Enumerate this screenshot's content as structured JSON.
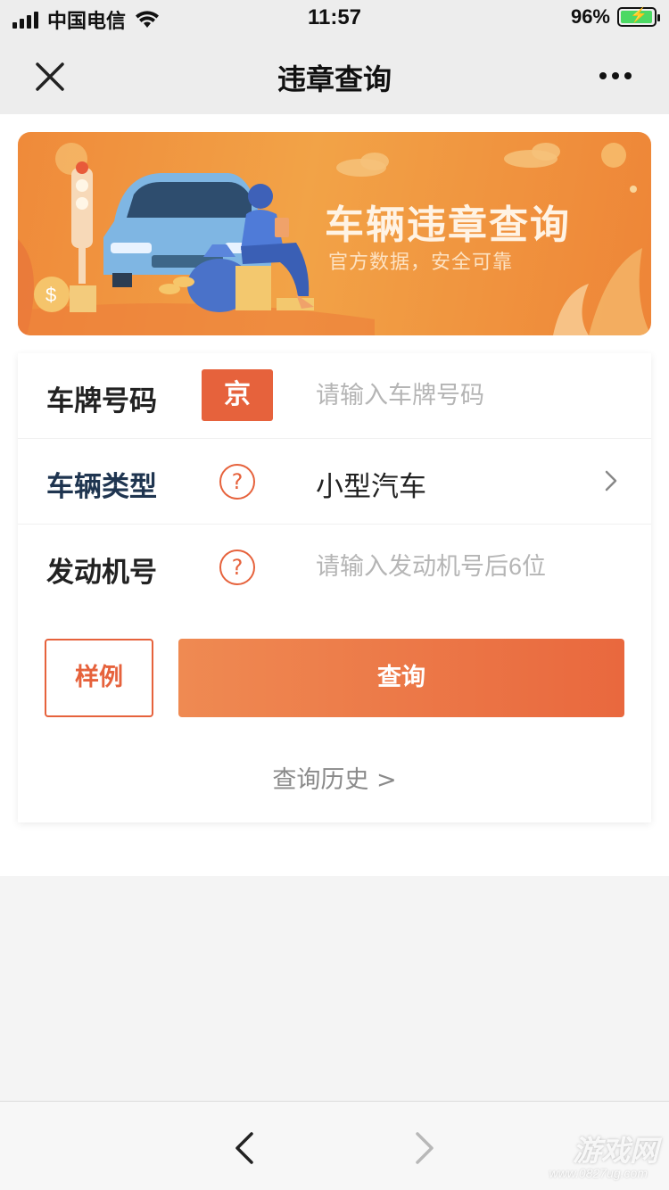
{
  "status_bar": {
    "carrier": "中国电信",
    "time": "11:57",
    "battery": "96%"
  },
  "nav": {
    "title": "违章查询"
  },
  "banner": {
    "title": "车辆违章查询",
    "subtitle": "官方数据，安全可靠"
  },
  "form": {
    "plate_label": "车牌号码",
    "plate_province": "京",
    "plate_placeholder": "请输入车牌号码",
    "vehicle_type_label": "车辆类型",
    "vehicle_type_value": "小型汽车",
    "engine_label": "发动机号",
    "engine_placeholder": "请输入发动机号后6位",
    "help_symbol": "?",
    "sample_label": "样例",
    "query_label": "查询",
    "history_label": "查询历史 >"
  },
  "watermark": {
    "text": "游戏网",
    "url": "www.0827ug.com"
  },
  "colors": {
    "accent": "#e6623c",
    "banner": "#f2a347"
  }
}
